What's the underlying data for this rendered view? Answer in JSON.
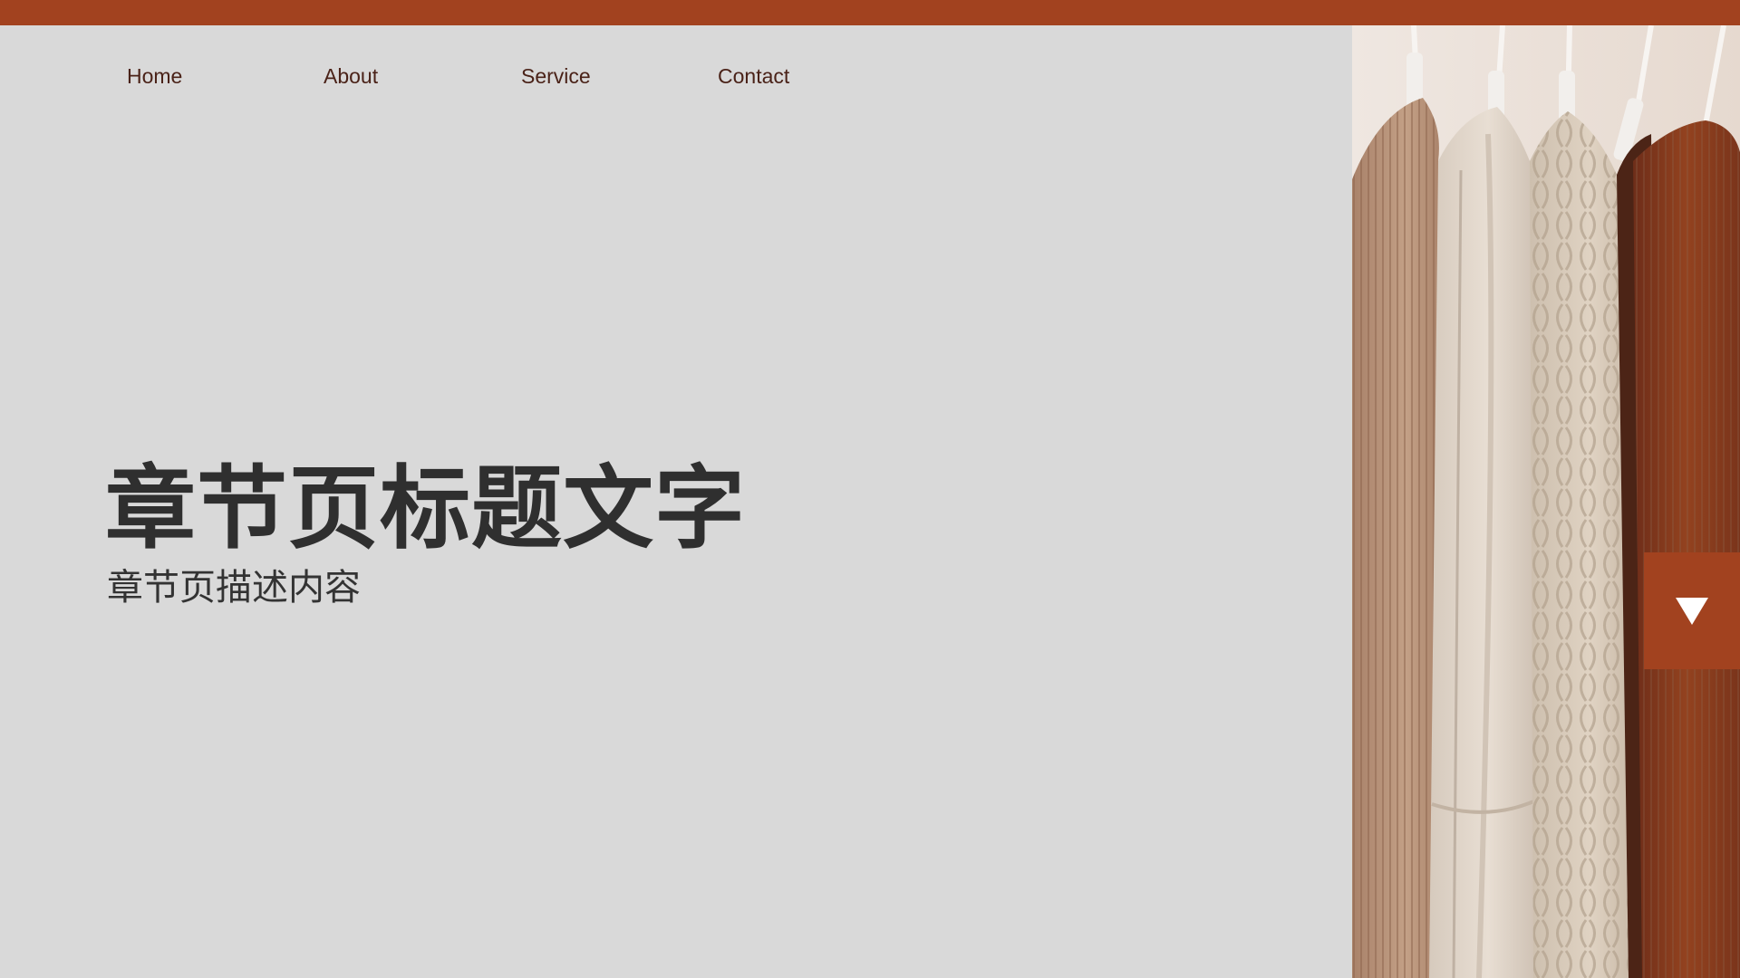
{
  "nav": {
    "items": [
      {
        "label": "Home"
      },
      {
        "label": "About"
      },
      {
        "label": "Service"
      },
      {
        "label": "Contact"
      }
    ]
  },
  "hero": {
    "title": "章节页标题文字",
    "subtitle": "章节页描述内容"
  },
  "colors": {
    "accent": "#a2421f",
    "background": "#d9d9d9",
    "text_dark": "#2f2f2f",
    "nav_text": "#4a2218"
  },
  "icons": {
    "scroll_button": "triangle-down-icon"
  }
}
